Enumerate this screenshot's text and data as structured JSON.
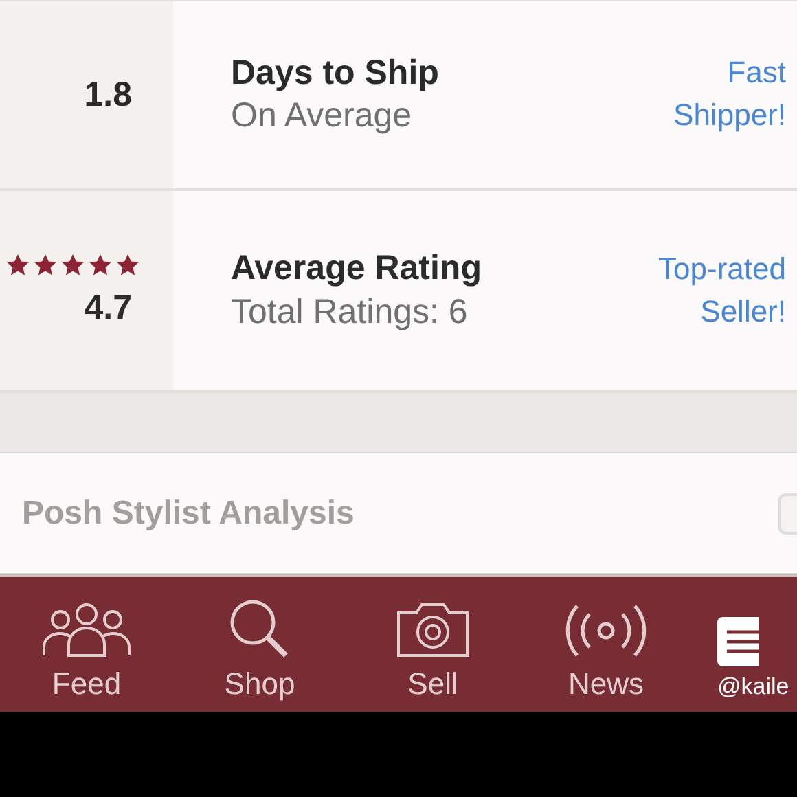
{
  "stats": [
    {
      "value": "1.8",
      "title": "Days to Ship",
      "subtitle": "On Average",
      "badge": "Fast Shipper!"
    },
    {
      "value": "4.7",
      "stars": 5,
      "title": "Average Rating",
      "subtitle": "Total Ratings: 6",
      "badge": "Top-rated Seller!"
    }
  ],
  "analysis": {
    "title": "Posh Stylist Analysis"
  },
  "tabbar": [
    {
      "kind": "feed",
      "label": "Feed",
      "selected": false
    },
    {
      "kind": "shop",
      "label": "Shop",
      "selected": false
    },
    {
      "kind": "sell",
      "label": "Sell",
      "selected": false
    },
    {
      "kind": "news",
      "label": "News",
      "selected": false
    },
    {
      "kind": "menu",
      "label": "@kaile",
      "selected": true
    }
  ]
}
